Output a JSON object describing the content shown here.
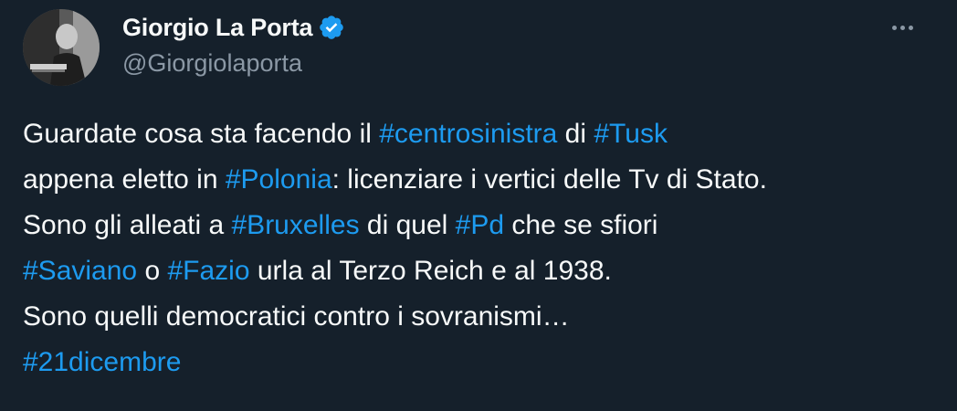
{
  "author": {
    "display_name": "Giorgio La Porta",
    "handle": "@Giorgiolaporta",
    "verified_icon": "verified-badge-icon"
  },
  "more_icon": "more-horizontal-icon",
  "colors": {
    "background": "#15202b",
    "text": "#f7f9f9",
    "muted": "#8b98a5",
    "link": "#1d9bf0"
  },
  "tweet": {
    "lines": [
      [
        {
          "t": "Guardate cosa sta facendo il ",
          "tag": false
        },
        {
          "t": "#centrosinistra",
          "tag": true
        },
        {
          "t": " di ",
          "tag": false
        },
        {
          "t": "#Tusk",
          "tag": true
        }
      ],
      [
        {
          "t": "appena eletto in ",
          "tag": false
        },
        {
          "t": "#Polonia",
          "tag": true
        },
        {
          "t": ": licenziare i vertici delle Tv di Stato.",
          "tag": false
        }
      ],
      [
        {
          "t": "Sono gli alleati a ",
          "tag": false
        },
        {
          "t": "#Bruxelles",
          "tag": true
        },
        {
          "t": " di quel ",
          "tag": false
        },
        {
          "t": "#Pd",
          "tag": true
        },
        {
          "t": " che se sfiori",
          "tag": false
        }
      ],
      [
        {
          "t": "#Saviano",
          "tag": true
        },
        {
          "t": " o ",
          "tag": false
        },
        {
          "t": "#Fazio",
          "tag": true
        },
        {
          "t": " urla al Terzo Reich e al 1938.",
          "tag": false
        }
      ],
      [
        {
          "t": "Sono quelli democratici contro i sovranismi…",
          "tag": false
        }
      ],
      [
        {
          "t": "#21dicembre",
          "tag": true
        }
      ]
    ]
  }
}
